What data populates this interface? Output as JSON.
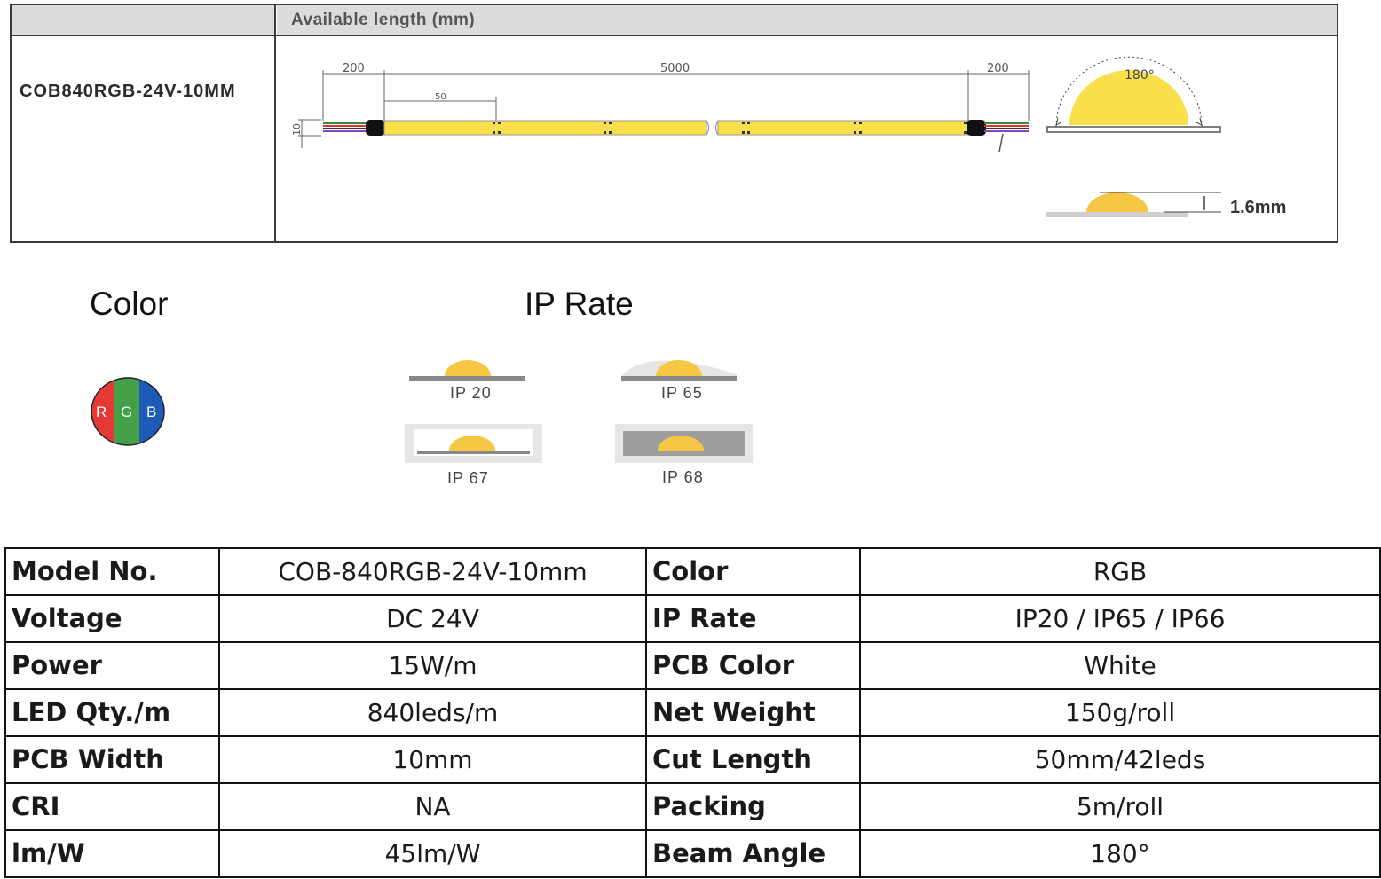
{
  "drawing": {
    "header_title": "Available length (mm)",
    "model_name": "COB840RGB-24V-10MM",
    "dim_lead_left": "200",
    "dim_total": "5000",
    "dim_lead_right": "200",
    "dim_cut": "50",
    "dim_width": "10",
    "beam_angle_label": "180°",
    "led_height_label": "1.6mm"
  },
  "headings": {
    "color": "Color",
    "ip_rate": "IP Rate"
  },
  "rgb_badge": {
    "r": "R",
    "g": "G",
    "b": "B",
    "colors": {
      "red": "#e53935",
      "green": "#43a047",
      "blue": "#1e5bb8"
    }
  },
  "ip_options": {
    "ip20": "IP 20",
    "ip65": "IP 65",
    "ip67": "IP 67",
    "ip68": "IP 68"
  },
  "specs": {
    "rows": [
      {
        "label_left": "Model No.",
        "value_left": "COB-840RGB-24V-10mm",
        "label_right": "Color",
        "value_right": "RGB"
      },
      {
        "label_left": "Voltage",
        "value_left": "DC 24V",
        "label_right": "IP Rate",
        "value_right": "IP20 / IP65 / IP66"
      },
      {
        "label_left": "Power",
        "value_left": "15W/m",
        "label_right": "PCB Color",
        "value_right": "White"
      },
      {
        "label_left": "LED Qty./m",
        "value_left": "840leds/m",
        "label_right": "Net Weight",
        "value_right": "150g/roll"
      },
      {
        "label_left": "PCB Width",
        "value_left": "10mm",
        "label_right": "Cut Length",
        "value_right": "50mm/42leds"
      },
      {
        "label_left": "CRI",
        "value_left": "NA",
        "label_right": "Packing",
        "value_right": "5m/roll"
      },
      {
        "label_left": "lm/W",
        "value_left": "45lm/W",
        "label_right": "Beam Angle",
        "value_right": "180°"
      }
    ]
  },
  "palette": {
    "led_yellow": "#f9e04b",
    "chip_amber": "#f6c744",
    "frame": "#3a3a3a",
    "header_gray": "#dcdcdc"
  }
}
